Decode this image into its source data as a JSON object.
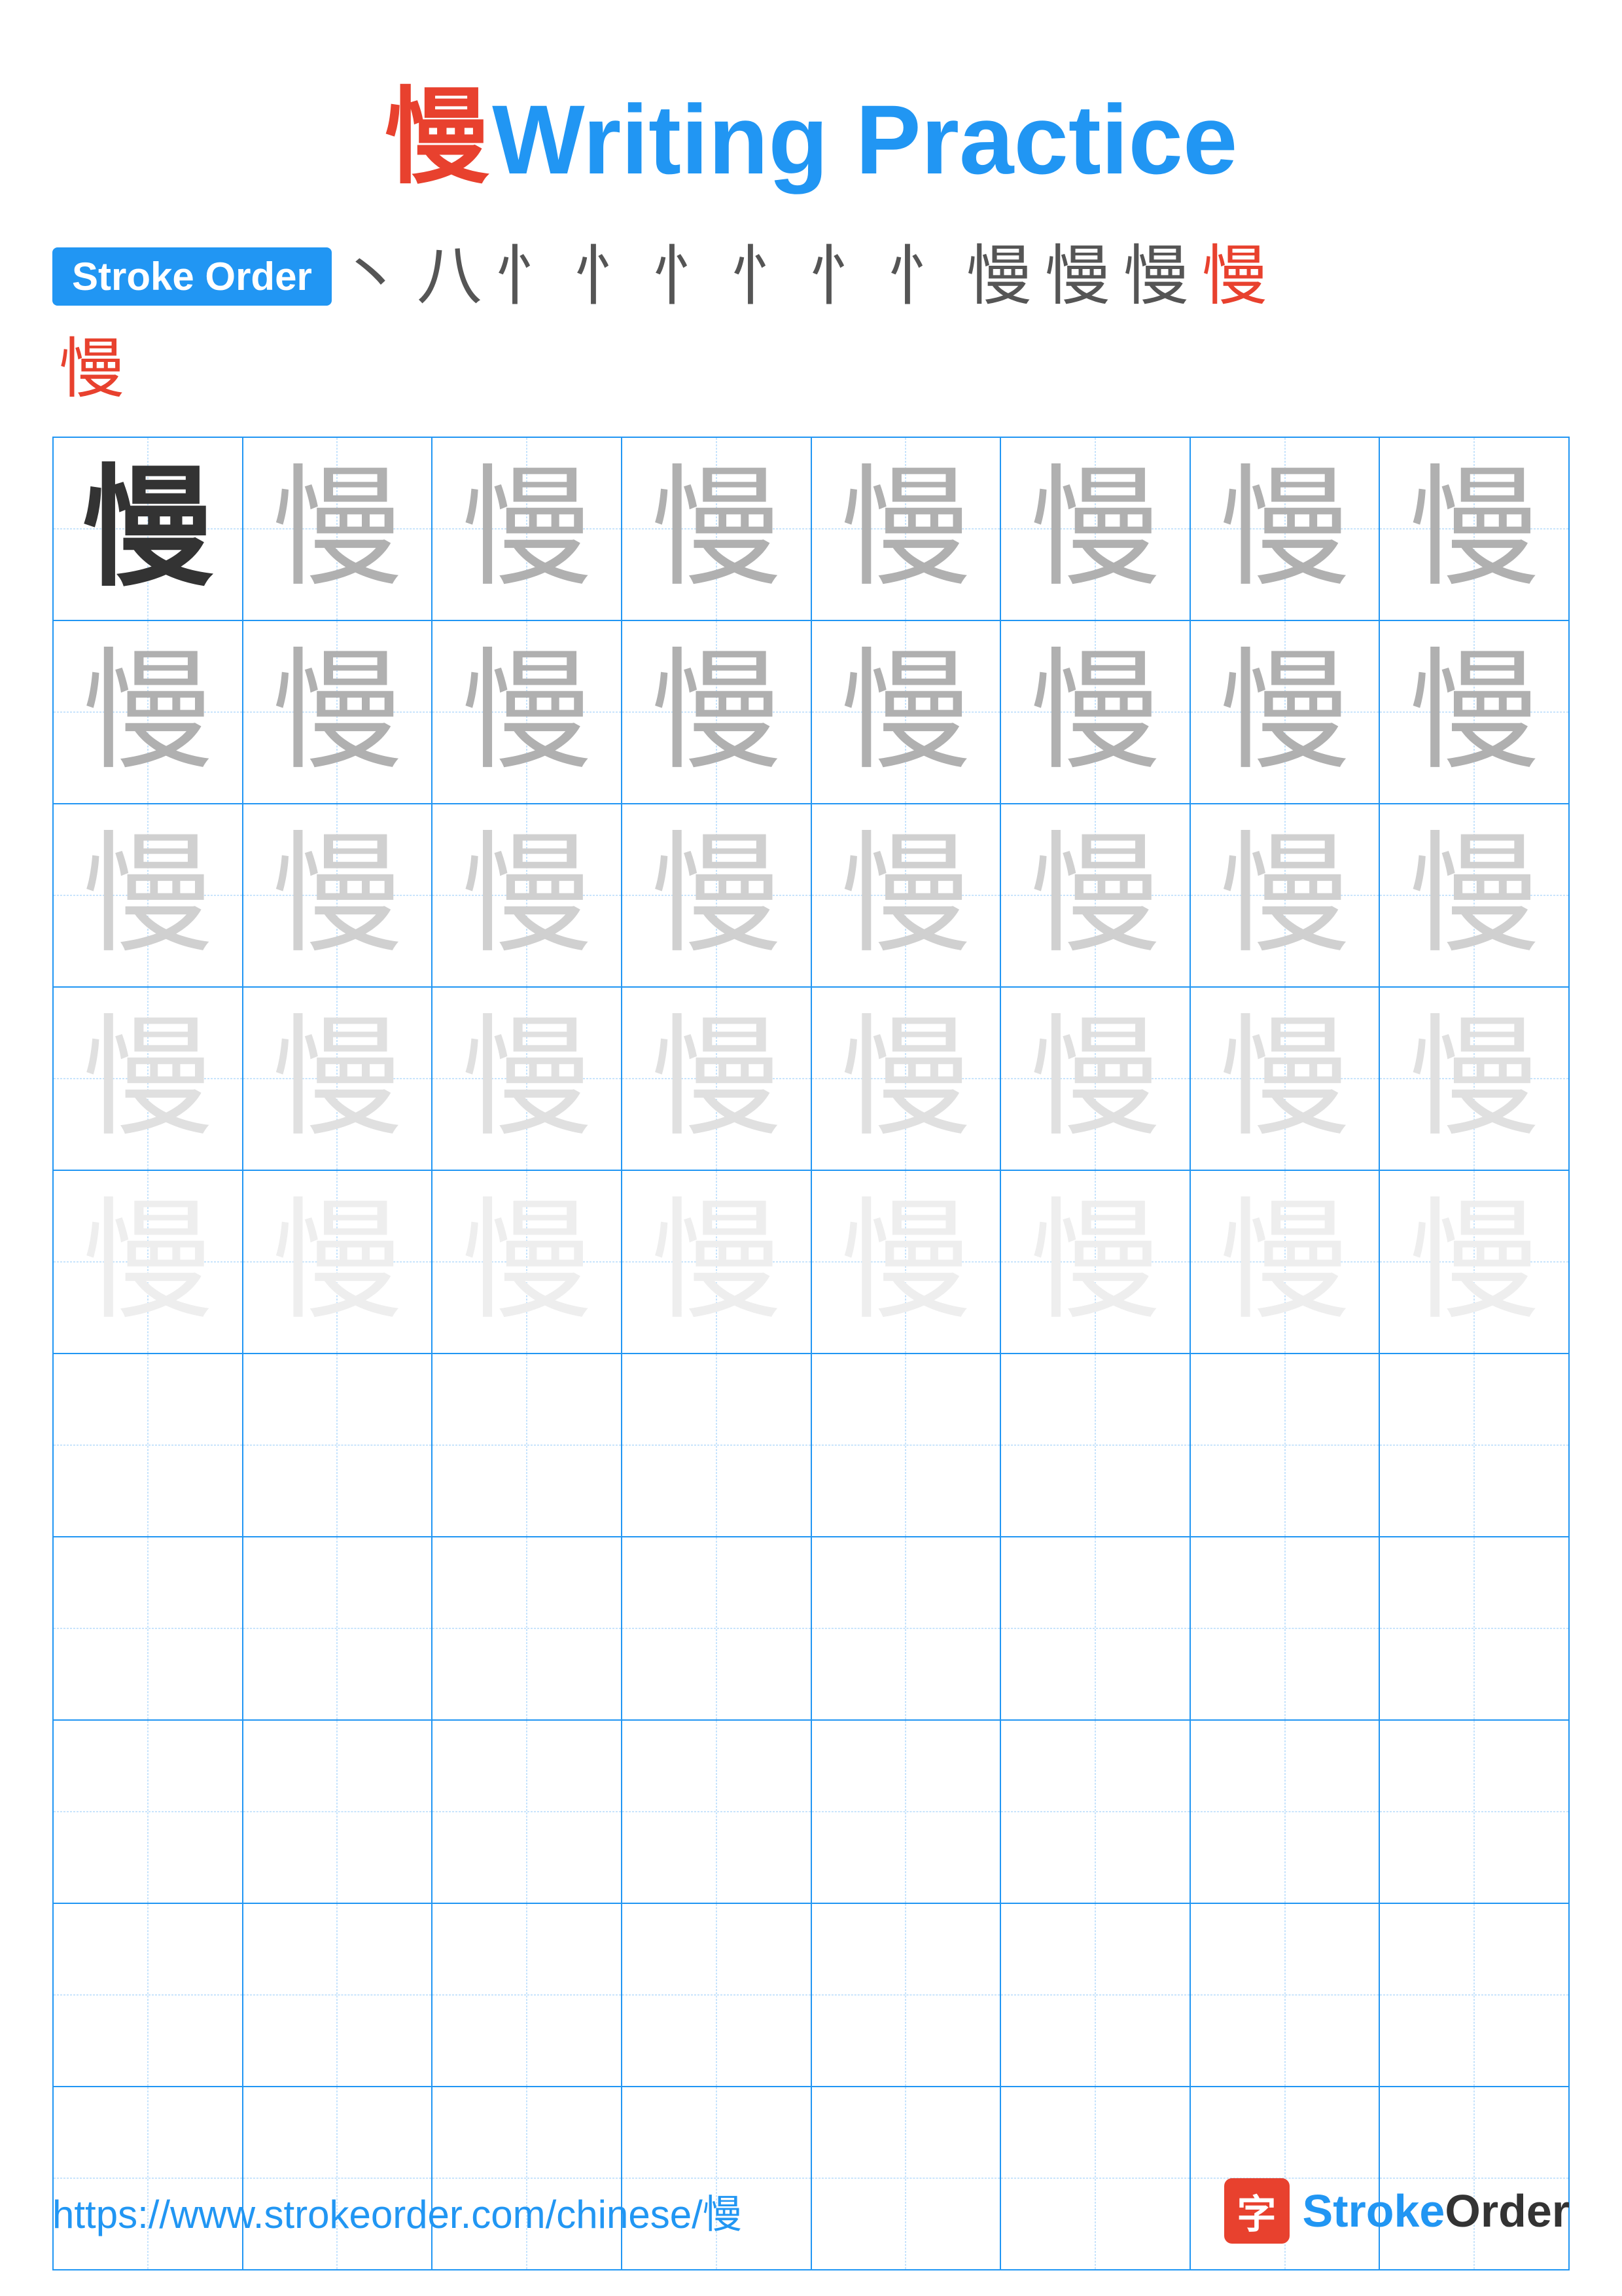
{
  "page": {
    "title_char": "慢",
    "title_text": "Writing Practice",
    "stroke_order_label": "Stroke Order",
    "stroke_sequence": [
      "丶",
      "八",
      "忄",
      "忄",
      "忄",
      "忄",
      "忄",
      "忄",
      "慢",
      "慢",
      "慢",
      "慢",
      "慢"
    ],
    "practice_char": "慢",
    "grid_rows": 10,
    "grid_cols": 8,
    "footer_url": "https://www.strokeorder.com/chinese/慢",
    "brand_icon": "字",
    "brand_name_stroke": "Stroke",
    "brand_name_order": "Order"
  }
}
